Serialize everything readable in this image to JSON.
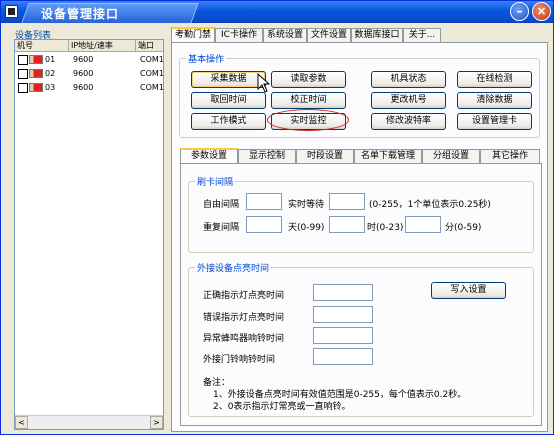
{
  "window": {
    "title": "设备管理接口"
  },
  "device_list": {
    "label": "设备列表",
    "columns": [
      "机号",
      "IP地址/速率",
      "端口"
    ],
    "rows": [
      {
        "no": "01",
        "speed": "9600",
        "port": "COM1"
      },
      {
        "no": "02",
        "speed": "9600",
        "port": "COM1"
      },
      {
        "no": "03",
        "speed": "9600",
        "port": "COM1"
      }
    ]
  },
  "main_tabs": [
    "考勤门禁",
    "IC卡操作",
    "系统设置",
    "文件设置",
    "数据库接口",
    "关于..."
  ],
  "basic_ops": {
    "title": "基本操作",
    "buttons": [
      "采集数据",
      "读取参数",
      "机具状态",
      "在线检测",
      "取回时间",
      "校正时间",
      "更改机号",
      "清除数据",
      "工作模式",
      "实时监控",
      "修改波特率",
      "设置管理卡"
    ]
  },
  "sub_tabs": [
    "参数设置",
    "显示控制",
    "时段设置",
    "名单下载管理",
    "分组设置",
    "其它操作"
  ],
  "swipe_interval": {
    "title": "刷卡间隔",
    "free_interval": "自由间隔",
    "realtime_wait": "实时等待",
    "range_note": "(0-255，1个单位表示0.25秒)",
    "repeat_interval": "重复间隔",
    "day": "天(0-99)",
    "hour": "时(0-23)",
    "minute": "分(0-59)"
  },
  "external": {
    "title": "外接设备点亮时间",
    "correct_light": "正确指示灯点亮时间",
    "error_light": "错误指示灯点亮时间",
    "buzzer": "异常蜂鸣器响铃时间",
    "doorbell": "外接门铃响铃时间",
    "write_button": "写入设置",
    "note_title": "备注：",
    "note1": "1、外接设备点亮时间有效值范围是0-255，每个值表示0.2秒。",
    "note2": "2、0表示指示灯常亮或一直响铃。"
  },
  "colors": {
    "title_bar": "#0a4ed2",
    "group_title": "#0046d5",
    "highlight": "#d21f1f"
  }
}
